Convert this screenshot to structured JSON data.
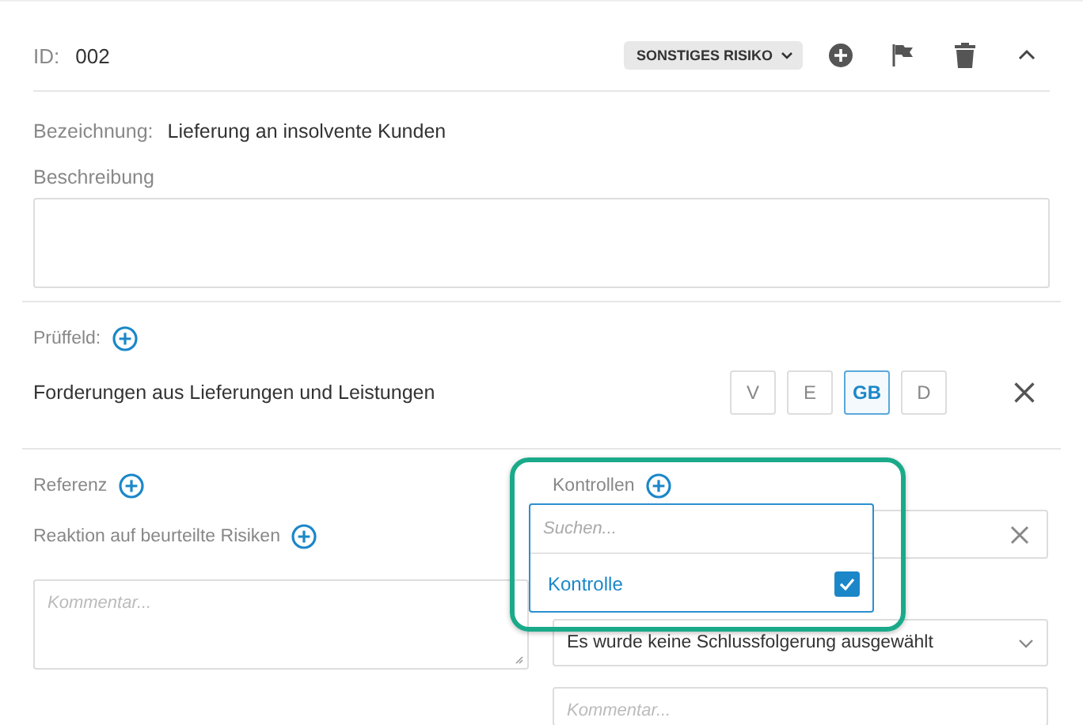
{
  "header": {
    "id_label": "ID:",
    "id": "002",
    "category": "SONSTIGES RISIKO",
    "expanded": true
  },
  "designation": {
    "label": "Bezeichnung:",
    "value": "Lieferung an insolvente Kunden"
  },
  "description": {
    "label": "Beschreibung"
  },
  "test_field": {
    "label": "Prüffeld:",
    "name": "Forderungen aus Lieferungen und Leistungen",
    "options": [
      {
        "label": "V",
        "selected": false
      },
      {
        "label": "E",
        "selected": false
      },
      {
        "label": "GB",
        "selected": true
      },
      {
        "label": "D",
        "selected": false
      }
    ]
  },
  "reference": {
    "label": "Referenz"
  },
  "reaction": {
    "label": "Reaktion auf beurteilte Risiken",
    "comment_placeholder": "Kommentar..."
  },
  "controls": {
    "label": "Kontrollen",
    "highlighted": true,
    "search_placeholder": "Suchen...",
    "items": [
      {
        "label": "Kontrolle",
        "checked": true
      }
    ]
  },
  "conclusion": {
    "value": "Es wurde keine Schlussfolgerung ausgewählt",
    "comment_placeholder": "Kommentar..."
  }
}
